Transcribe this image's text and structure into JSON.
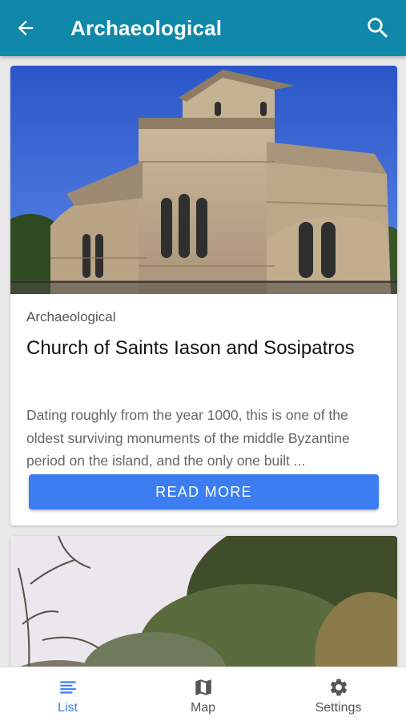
{
  "appbar": {
    "title": "Archaeological",
    "back_icon": "arrow-back-icon",
    "search_icon": "search-icon",
    "color": "#0f88aa"
  },
  "cards": [
    {
      "category": "Archaeological",
      "title": "Church of Saints Iason and Sosipatros",
      "description": "Dating roughly from the year 1000, this is one of the oldest surviving monuments of the middle Byzantine period on the island, and the only one built ...",
      "button_label": "READ MORE"
    }
  ],
  "bottom_nav": {
    "items": [
      {
        "label": "List",
        "icon": "list-icon",
        "active": true
      },
      {
        "label": "Map",
        "icon": "map-icon",
        "active": false
      },
      {
        "label": "Settings",
        "icon": "gear-icon",
        "active": false
      }
    ],
    "active_color": "#3c7ef1"
  }
}
